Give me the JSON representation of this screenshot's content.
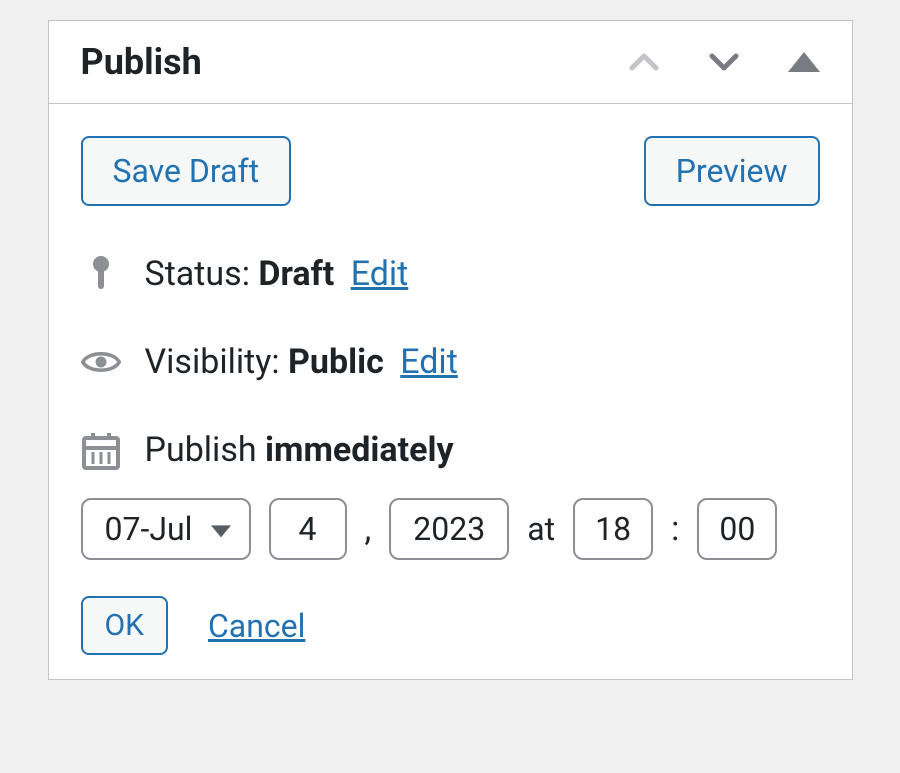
{
  "panel": {
    "title": "Publish"
  },
  "buttons": {
    "save_draft": "Save Draft",
    "preview": "Preview",
    "ok": "OK",
    "cancel": "Cancel"
  },
  "status": {
    "label": "Status: ",
    "value": "Draft",
    "edit": "Edit"
  },
  "visibility": {
    "label": "Visibility: ",
    "value": "Public",
    "edit": "Edit"
  },
  "schedule": {
    "label": "Publish ",
    "value": "immediately",
    "month": "07-Jul",
    "day": "4",
    "year": "2023",
    "at": "at",
    "hour": "18",
    "minute": "00",
    "comma": ",",
    "colon": ":"
  }
}
